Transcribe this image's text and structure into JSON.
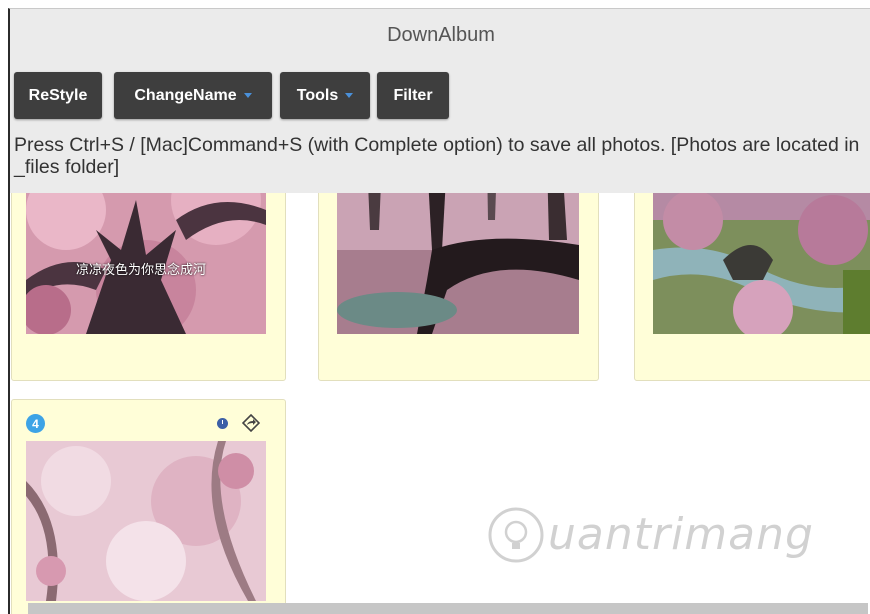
{
  "app": {
    "title": "DownAlbum"
  },
  "toolbar": {
    "buttons": [
      {
        "label": "ReStyle",
        "dropdown": false
      },
      {
        "label": "ChangeName",
        "dropdown": true
      },
      {
        "label": "Tools",
        "dropdown": true
      },
      {
        "label": "Filter",
        "dropdown": false
      }
    ]
  },
  "message": "Press Ctrl+S / [Mac]Command+S (with Complete option) to save all photos. [Photos are located in _files folder]",
  "photos": [
    {
      "caption": "凉凉夜色为你思念成河"
    },
    {
      "caption": ""
    },
    {
      "caption": ""
    },
    {
      "badge": "4",
      "icons": [
        "clock-icon",
        "share-icon"
      ]
    }
  ],
  "watermark": {
    "text": "uantrimang"
  },
  "colors": {
    "toolbar_bg": "#ebebeb",
    "button_bg": "#3e3e3e",
    "card_bg": "#fffed8",
    "badge": "#3da3e6",
    "caret": "#4a90d9"
  }
}
